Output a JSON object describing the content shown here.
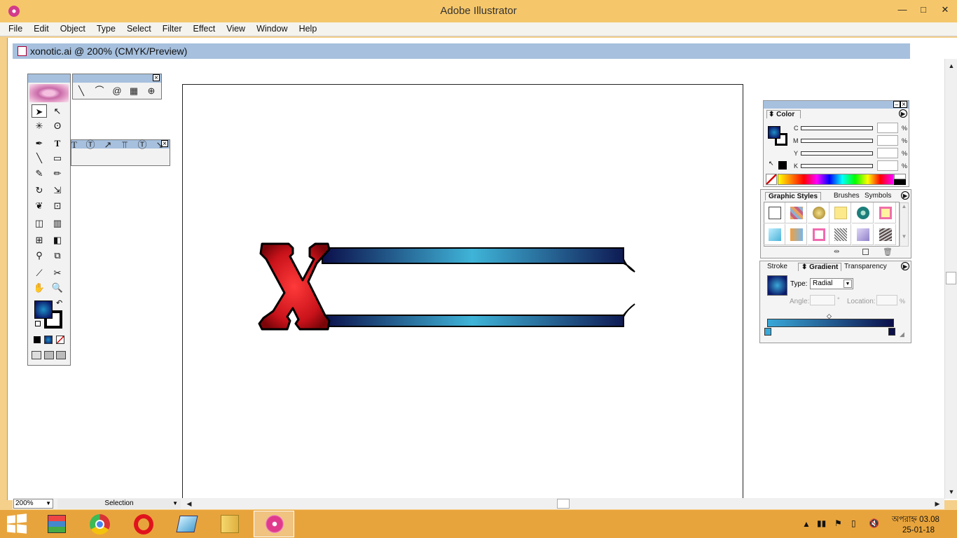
{
  "window": {
    "title": "Adobe Illustrator",
    "minimize": "—",
    "maximize": "□",
    "close": "✕"
  },
  "menu": [
    "File",
    "Edit",
    "Object",
    "Type",
    "Select",
    "Filter",
    "Effect",
    "View",
    "Window",
    "Help"
  ],
  "document": {
    "title": "xonotic.ai @ 200% (CMYK/Preview)"
  },
  "status": {
    "zoom": "200%",
    "mode": "Selection"
  },
  "color_panel": {
    "tab": "Color",
    "channels": [
      "C",
      "M",
      "Y",
      "K"
    ],
    "pct": "%"
  },
  "styles_panel": {
    "tabs": [
      "Graphic Styles",
      "Brushes",
      "Symbols"
    ]
  },
  "gradient_panel": {
    "tabs": [
      "Stroke",
      "Gradient",
      "Transparency"
    ],
    "type_label": "Type:",
    "type_value": "Radial",
    "angle_label": "Angle:",
    "angle_unit": "°",
    "location_label": "Location:",
    "location_unit": "%"
  },
  "taskbar": {
    "time": "অপরাহ্ন 03.08",
    "date": "25-01-18"
  },
  "colors": {
    "titlebar": "#f6c76a",
    "docbar": "#a6c0de",
    "taskbar": "#e8a43c",
    "logo_red": "#c8121a",
    "bar_navy": "#0b0f4a",
    "bar_cyan": "#3fb4d8"
  }
}
